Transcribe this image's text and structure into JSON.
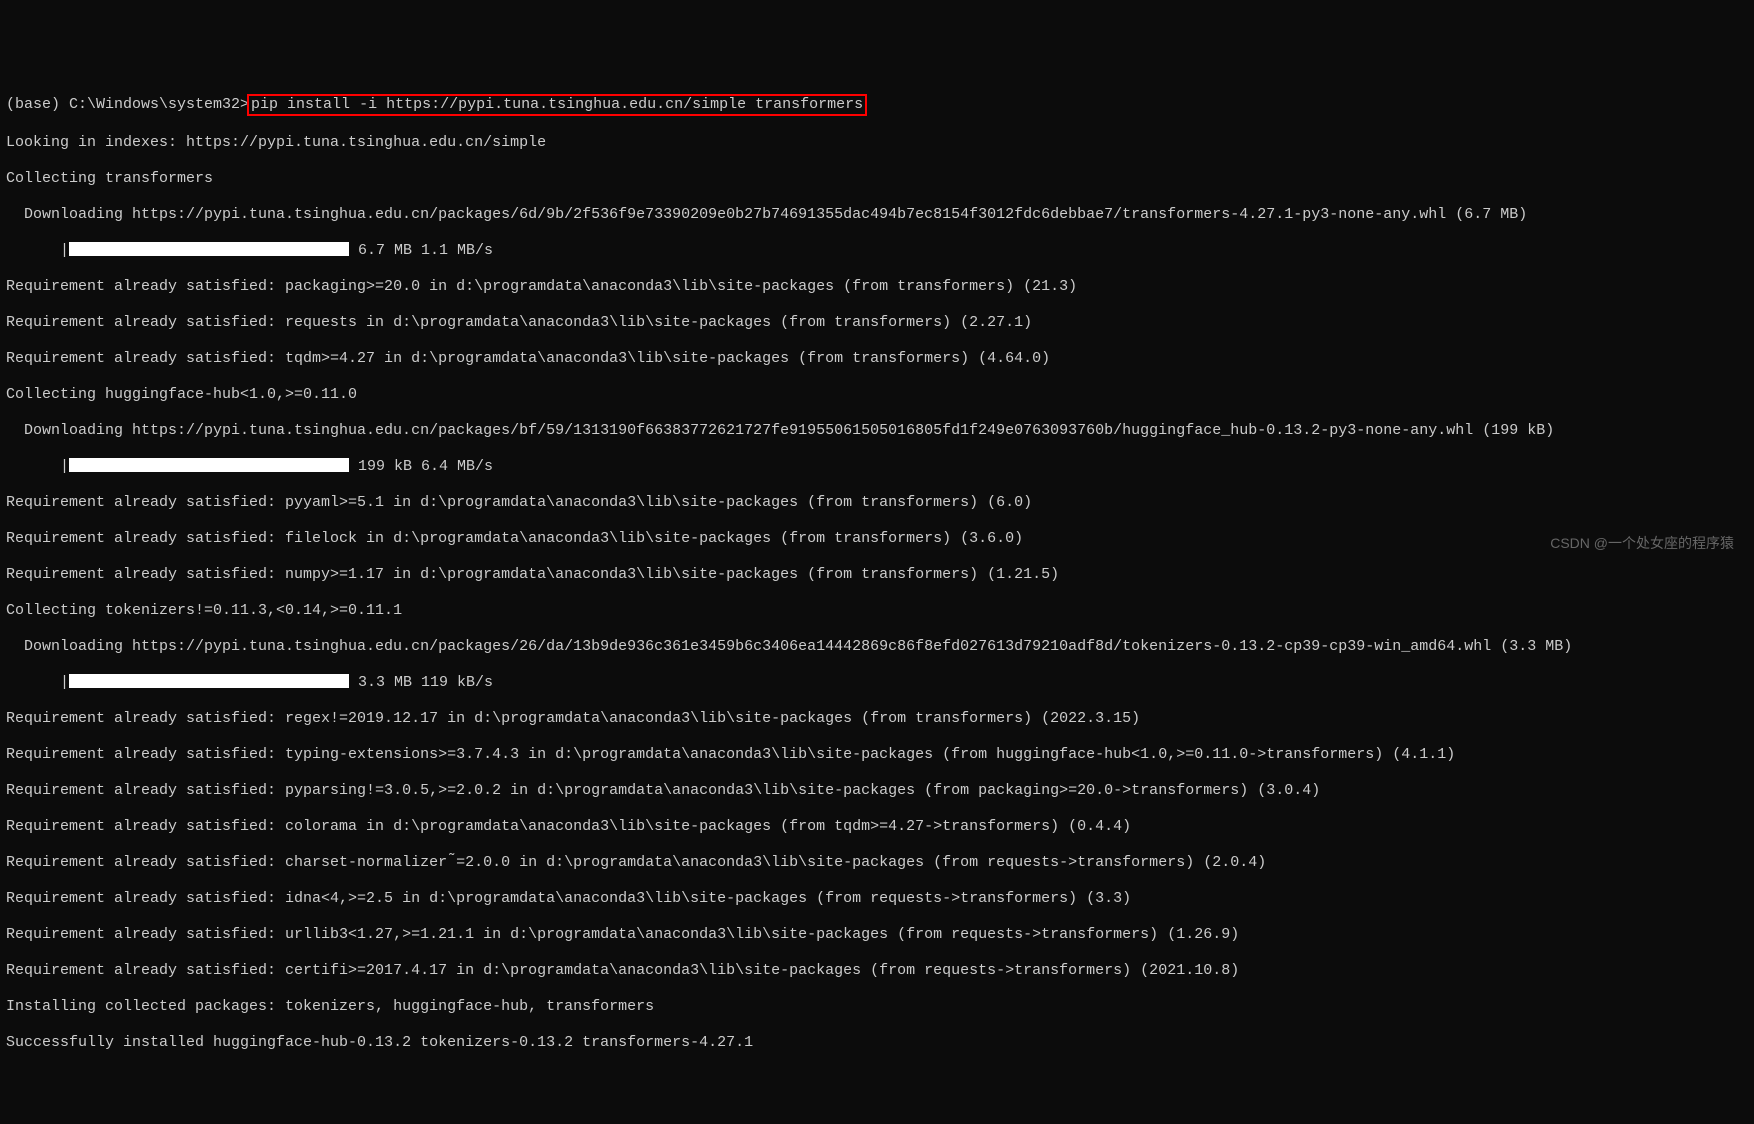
{
  "prompt": {
    "env": "(base) ",
    "path": "C:\\Windows\\system32>",
    "command": "pip install -i https://pypi.tuna.tsinghua.edu.cn/simple transformers"
  },
  "lines": {
    "l01": "Looking in indexes: https://pypi.tuna.tsinghua.edu.cn/simple",
    "l02": "Collecting transformers",
    "l03": "Downloading https://pypi.tuna.tsinghua.edu.cn/packages/6d/9b/2f536f9e73390209e0b27b74691355dac494b7ec8154f3012fdc6debbae7/transformers-4.27.1-py3-none-any.whl (6.7 MB)",
    "l04_speed": " 6.7 MB 1.1 MB/s",
    "l05": "Requirement already satisfied: packaging>=20.0 in d:\\programdata\\anaconda3\\lib\\site-packages (from transformers) (21.3)",
    "l06": "Requirement already satisfied: requests in d:\\programdata\\anaconda3\\lib\\site-packages (from transformers) (2.27.1)",
    "l07": "Requirement already satisfied: tqdm>=4.27 in d:\\programdata\\anaconda3\\lib\\site-packages (from transformers) (4.64.0)",
    "l08": "Collecting huggingface-hub<1.0,>=0.11.0",
    "l09": "Downloading https://pypi.tuna.tsinghua.edu.cn/packages/bf/59/1313190f66383772621727fe91955061505016805fd1f249e0763093760b/huggingface_hub-0.13.2-py3-none-any.whl (199 kB)",
    "l10_speed": " 199 kB 6.4 MB/s",
    "l11": "Requirement already satisfied: pyyaml>=5.1 in d:\\programdata\\anaconda3\\lib\\site-packages (from transformers) (6.0)",
    "l12": "Requirement already satisfied: filelock in d:\\programdata\\anaconda3\\lib\\site-packages (from transformers) (3.6.0)",
    "l13": "Requirement already satisfied: numpy>=1.17 in d:\\programdata\\anaconda3\\lib\\site-packages (from transformers) (1.21.5)",
    "l14": "Collecting tokenizers!=0.11.3,<0.14,>=0.11.1",
    "l15": "Downloading https://pypi.tuna.tsinghua.edu.cn/packages/26/da/13b9de936c361e3459b6c3406ea14442869c86f8efd027613d79210adf8d/tokenizers-0.13.2-cp39-cp39-win_amd64.whl (3.3 MB)",
    "l16_speed": " 3.3 MB 119 kB/s",
    "l17": "Requirement already satisfied: regex!=2019.12.17 in d:\\programdata\\anaconda3\\lib\\site-packages (from transformers) (2022.3.15)",
    "l18": "Requirement already satisfied: typing-extensions>=3.7.4.3 in d:\\programdata\\anaconda3\\lib\\site-packages (from huggingface-hub<1.0,>=0.11.0->transformers) (4.1.1)",
    "l19": "Requirement already satisfied: pyparsing!=3.0.5,>=2.0.2 in d:\\programdata\\anaconda3\\lib\\site-packages (from packaging>=20.0->transformers) (3.0.4)",
    "l20": "Requirement already satisfied: colorama in d:\\programdata\\anaconda3\\lib\\site-packages (from tqdm>=4.27->transformers) (0.4.4)",
    "l21": "Requirement already satisfied: charset-normalizer ̃=2.0.0 in d:\\programdata\\anaconda3\\lib\\site-packages (from requests->transformers) (2.0.4)",
    "l22": "Requirement already satisfied: idna<4,>=2.5 in d:\\programdata\\anaconda3\\lib\\site-packages (from requests->transformers) (3.3)",
    "l23": "Requirement already satisfied: urllib3<1.27,>=1.21.1 in d:\\programdata\\anaconda3\\lib\\site-packages (from requests->transformers) (1.26.9)",
    "l24": "Requirement already satisfied: certifi>=2017.4.17 in d:\\programdata\\anaconda3\\lib\\site-packages (from requests->transformers) (2021.10.8)",
    "l25": "Installing collected packages: tokenizers, huggingface-hub, transformers",
    "l26": "Successfully installed huggingface-hub-0.13.2 tokenizers-0.13.2 transformers-4.27.1"
  },
  "watermark": "CSDN @一个处女座的程序猿",
  "bar_prefix": "|"
}
